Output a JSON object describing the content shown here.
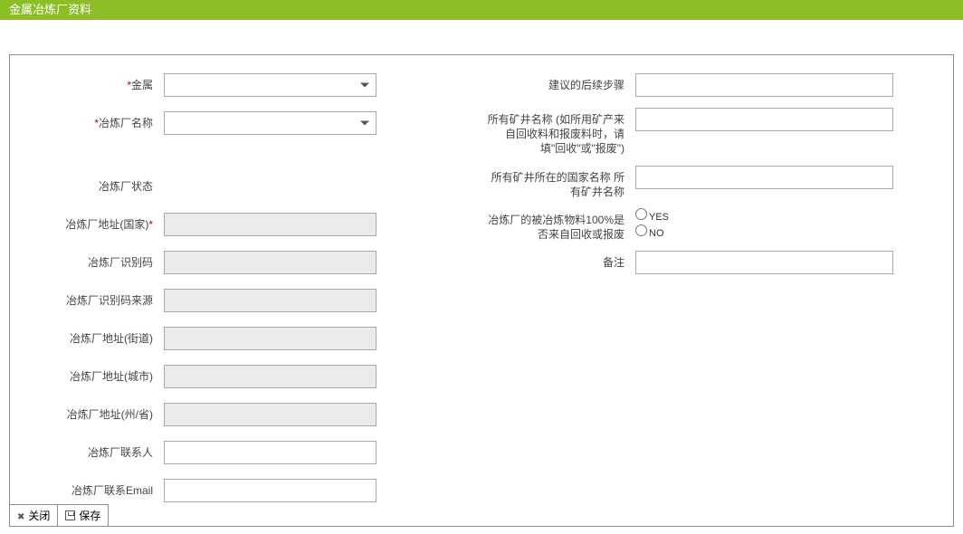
{
  "header": {
    "title": "金属冶炼厂资料"
  },
  "left": {
    "metal": {
      "label": "金属",
      "required": true,
      "value": ""
    },
    "smelterName": {
      "label": "冶炼厂名称",
      "required": true,
      "value": ""
    },
    "status": {
      "label": "冶炼厂状态",
      "value": ""
    },
    "country": {
      "label": "冶炼厂地址(国家)",
      "requiredSuffix": true,
      "value": ""
    },
    "identifier": {
      "label": "冶炼厂识别码",
      "value": ""
    },
    "idSource": {
      "label": "冶炼厂识别码来源",
      "value": ""
    },
    "street": {
      "label": "冶炼厂地址(街道)",
      "value": ""
    },
    "city": {
      "label": "冶炼厂地址(城市)",
      "value": ""
    },
    "state": {
      "label": "冶炼厂地址(州/省)",
      "value": ""
    },
    "contact": {
      "label": "冶炼厂联系人",
      "value": ""
    },
    "email": {
      "label": "冶炼厂联系Email",
      "value": ""
    }
  },
  "right": {
    "nextSteps": {
      "label": "建议的后续步骤",
      "value": ""
    },
    "mineNames": {
      "label": "所有矿井名称 (如所用矿产来自回收料和报废料时，请填\"回收\"或\"报废\")",
      "value": ""
    },
    "mineCountries": {
      "label": "所有矿井所在的国家名称 所有矿井名称",
      "value": ""
    },
    "recycled": {
      "label": "冶炼厂的被冶炼物料100%是否来自回收或报废",
      "yes": "YES",
      "no": "NO"
    },
    "remark": {
      "label": "备注",
      "value": ""
    }
  },
  "footer": {
    "close": "关闭",
    "save": "保存"
  }
}
